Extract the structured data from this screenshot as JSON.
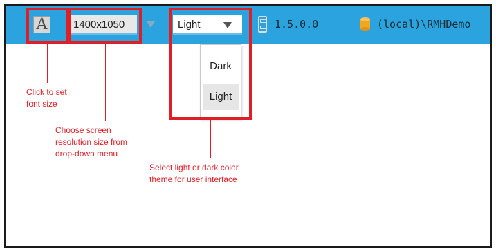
{
  "toolbar": {
    "font_button_glyph": "A",
    "resolution_value": "1400x1050",
    "theme_value": "Light",
    "version": "1.5.0.0",
    "server": "(local)\\RMHDemo",
    "background_color": "#2aa3de"
  },
  "theme_menu": {
    "options": [
      "Dark",
      "Light"
    ],
    "selected": "Light"
  },
  "annotations": {
    "font_note": "Click to set\nfont size",
    "resolution_note": "Choose screen\nresolution size from\ndrop-down menu",
    "theme_note": "Select light or dark color\ntheme for user interface",
    "callout_color": "#e01e26"
  },
  "icons": {
    "version_icon": "archive-cabinet-icon",
    "server_icon": "database-cylinder-icon"
  }
}
